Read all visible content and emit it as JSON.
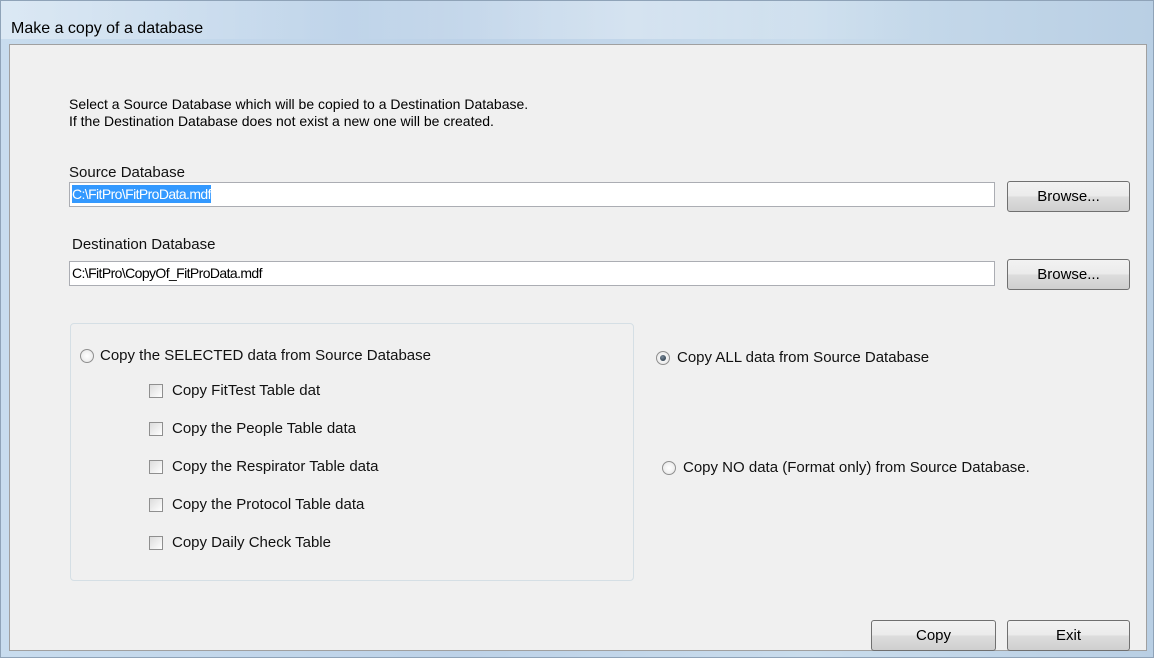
{
  "window": {
    "title": "Make a copy of a database"
  },
  "intro": {
    "line1": "Select a Source Database which will be copied to a Destination Database.",
    "line2": "If the Destination Database does not exist a new one will be created."
  },
  "source": {
    "label": "Source Database",
    "value": "C:\\FitPro\\FitProData.mdf",
    "browse_label": "Browse..."
  },
  "destination": {
    "label": "Destination Database",
    "value": "C:\\FitPro\\CopyOf_FitProData.mdf",
    "browse_label": "Browse..."
  },
  "options": {
    "selected_label": "Copy the SELECTED data from Source Database",
    "all_label": "Copy ALL data from Source Database",
    "none_label": "Copy NO data (Format only) from Source Database.",
    "checked": "all",
    "tables": [
      {
        "label": "Copy FitTest Table dat",
        "checked": false
      },
      {
        "label": "Copy the People Table data",
        "checked": false
      },
      {
        "label": "Copy the Respirator Table data",
        "checked": false
      },
      {
        "label": "Copy the Protocol Table data",
        "checked": false
      },
      {
        "label": "Copy Daily Check Table",
        "checked": false
      }
    ]
  },
  "actions": {
    "copy_label": "Copy",
    "exit_label": "Exit"
  }
}
